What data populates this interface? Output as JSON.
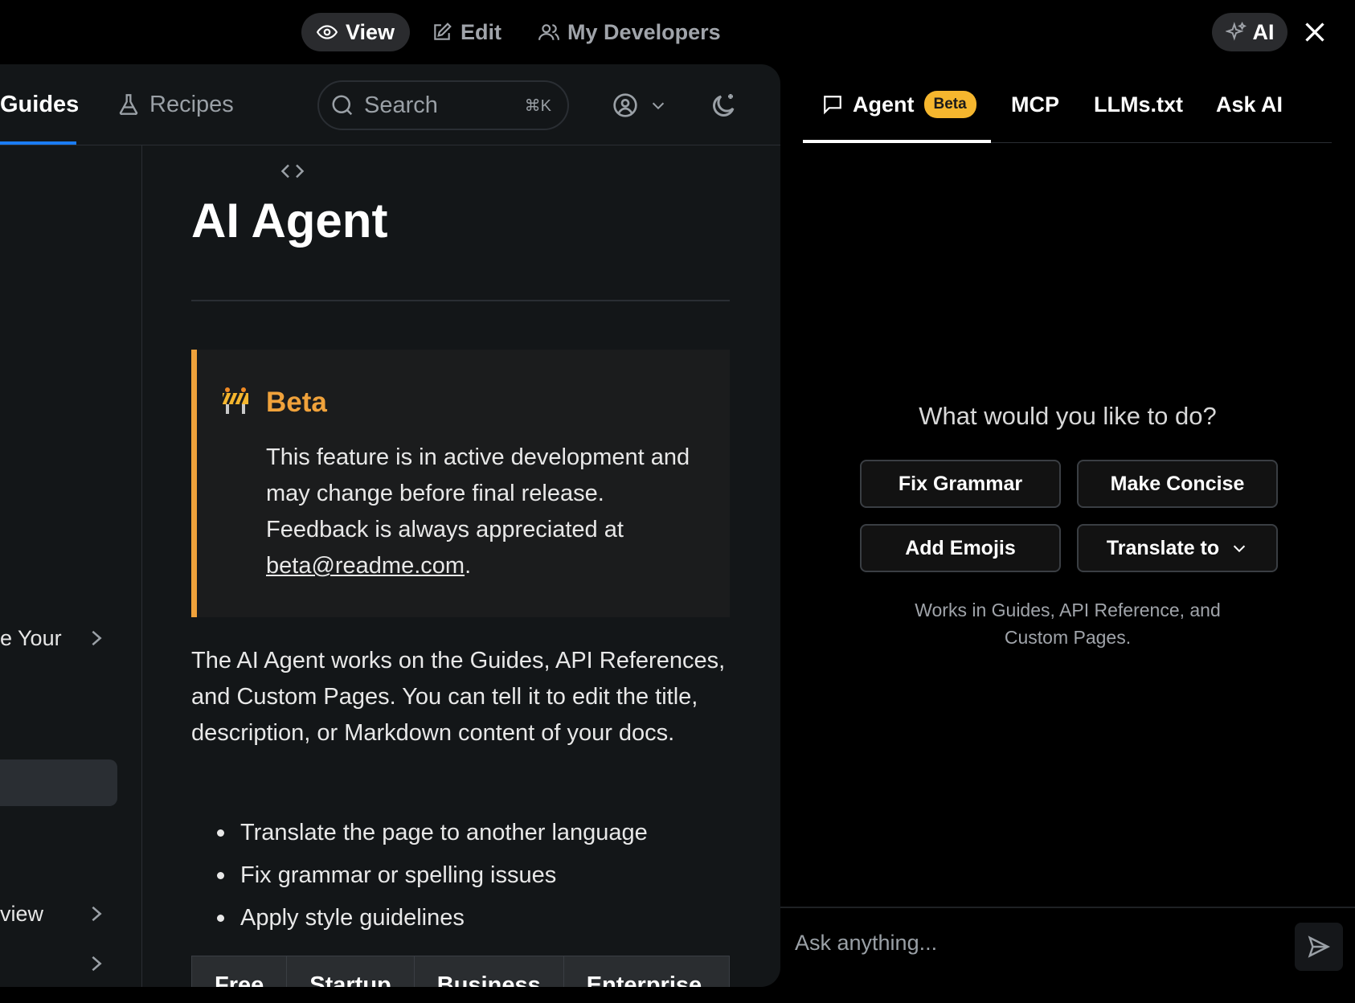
{
  "topbar": {
    "modes": [
      {
        "label": "View",
        "icon": "eye-icon",
        "active": true
      },
      {
        "label": "Edit",
        "icon": "edit-icon",
        "active": false
      },
      {
        "label": "My Developers",
        "icon": "users-icon",
        "active": false
      }
    ],
    "ai_label": "AI"
  },
  "docs_nav": {
    "tabs": [
      {
        "label": "Guides",
        "active": true
      },
      {
        "label": "Recipes",
        "icon": "flask-icon",
        "active": false
      }
    ],
    "search": {
      "placeholder": "Search",
      "shortcut": "⌘K"
    }
  },
  "sidebar": {
    "items": [
      {
        "label": "e Your"
      },
      {
        "label": "view"
      }
    ]
  },
  "page": {
    "title": "AI Agent",
    "callout": {
      "title": "Beta",
      "body": "This feature is in active development and may change before final release. Feedback is always appreciated at ",
      "link": "beta@readme.com",
      "tail": "."
    },
    "paragraph": "The AI Agent works on the Guides, API References, and Custom Pages. You can tell it to edit the title, description, or Markdown content of your docs.",
    "bullets": [
      "Translate the page to another language",
      "Fix grammar or spelling issues",
      "Apply style guidelines"
    ],
    "table_headers": [
      "Free",
      "Startup",
      "Business",
      "Enterprise"
    ]
  },
  "ai_panel": {
    "tabs": [
      {
        "label": "Agent",
        "badge": "Beta",
        "active": true
      },
      {
        "label": "MCP"
      },
      {
        "label": "LLMs.txt"
      },
      {
        "label": "Ask AI"
      }
    ],
    "question": "What would you like to do?",
    "actions": [
      "Fix Grammar",
      "Make Concise",
      "Add Emojis",
      "Translate to"
    ],
    "hint": "Works in Guides, API Reference, and Custom Pages.",
    "composer_placeholder": "Ask anything..."
  },
  "colors": {
    "accent_blue": "#1b7cf3",
    "beta_orange": "#f0a23b",
    "badge_yellow": "#f5b62e"
  }
}
